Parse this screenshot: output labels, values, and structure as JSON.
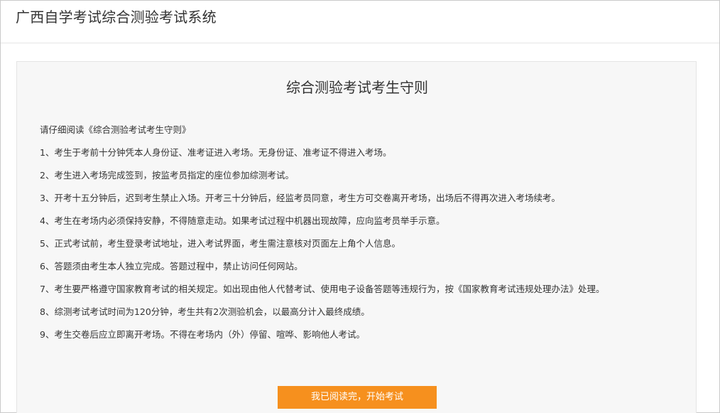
{
  "header": {
    "title": "广西自学考试综合测验考试系统"
  },
  "panel": {
    "title": "综合测验考试考生守则",
    "intro": "请仔细阅读《综合测验考试考生守则》",
    "rules": [
      "1、考生于考前十分钟凭本人身份证、准考证进入考场。无身份证、准考证不得进入考场。",
      "2、考生进入考场完成签到，按监考员指定的座位参加综测考试。",
      "3、开考十五分钟后，迟到考生禁止入场。开考三十分钟后，经监考员同意，考生方可交卷离开考场，出场后不得再次进入考场续考。",
      "4、考生在考场内必须保持安静，不得随意走动。如果考试过程中机器出现故障，应向监考员举手示意。",
      "5、正式考试前，考生登录考试地址，进入考试界面，考生需注意核对页面左上角个人信息。",
      "6、答题须由考生本人独立完成。答题过程中，禁止访问任何网站。",
      "7、考生要严格遵守国家教育考试的相关规定。如出现由他人代替考试、使用电子设备答题等违规行为，按《国家教育考试违规处理办法》处理。",
      "8、综测考试考试时间为120分钟，考生共有2次测验机会，以最高分计入最终成绩。",
      "9、考生交卷后应立即离开考场。不得在考场内（外）停留、喧哗、影响他人考试。"
    ],
    "start_button_label": "我已阅读完，开始考试"
  },
  "colors": {
    "accent": "#f6901e",
    "panel_background": "#f7f7f7",
    "text": "#333333"
  }
}
